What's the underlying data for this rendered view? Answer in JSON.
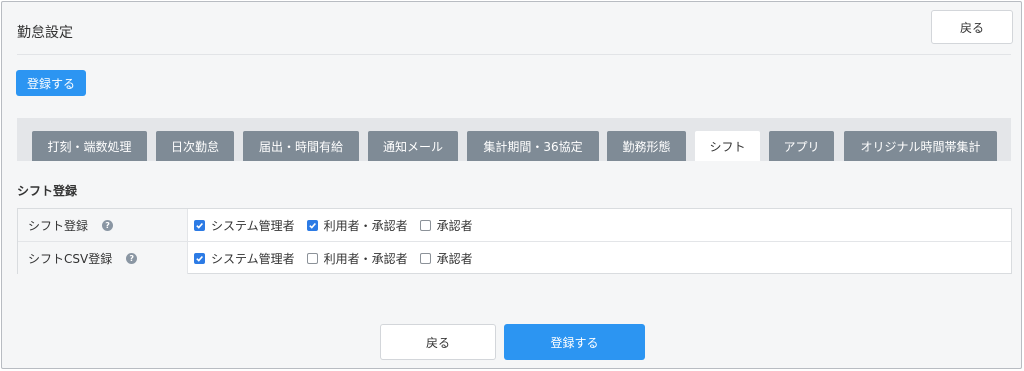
{
  "header": {
    "title": "勤怠設定",
    "back_label": "戻る"
  },
  "toolbar": {
    "register_label": "登録する"
  },
  "tabs": [
    {
      "label": "打刻・端数処理",
      "active": false
    },
    {
      "label": "日次勤怠",
      "active": false
    },
    {
      "label": "届出・時間有給",
      "active": false
    },
    {
      "label": "通知メール",
      "active": false
    },
    {
      "label": "集計期間・36協定",
      "active": false
    },
    {
      "label": "勤務形態",
      "active": false
    },
    {
      "label": "シフト",
      "active": true
    },
    {
      "label": "アプリ",
      "active": false
    },
    {
      "label": "オリジナル時間帯集計",
      "active": false
    }
  ],
  "section": {
    "title": "シフト登録"
  },
  "permissions": [
    {
      "label": "シフト登録",
      "help_icon": "question-circle-icon",
      "options": [
        {
          "label": "システム管理者",
          "checked": true
        },
        {
          "label": "利用者・承認者",
          "checked": true
        },
        {
          "label": "承認者",
          "checked": false
        }
      ]
    },
    {
      "label": "シフトCSV登録",
      "help_icon": "question-circle-icon",
      "options": [
        {
          "label": "システム管理者",
          "checked": true
        },
        {
          "label": "利用者・承認者",
          "checked": false
        },
        {
          "label": "承認者",
          "checked": false
        }
      ]
    }
  ],
  "footer": {
    "back_label": "戻る",
    "register_label": "登録する"
  },
  "colors": {
    "primary": "#2c95f2",
    "tab_inactive": "#7f8b96",
    "checkbox_checked": "#2c7be5",
    "background": "#f5f6f7"
  }
}
